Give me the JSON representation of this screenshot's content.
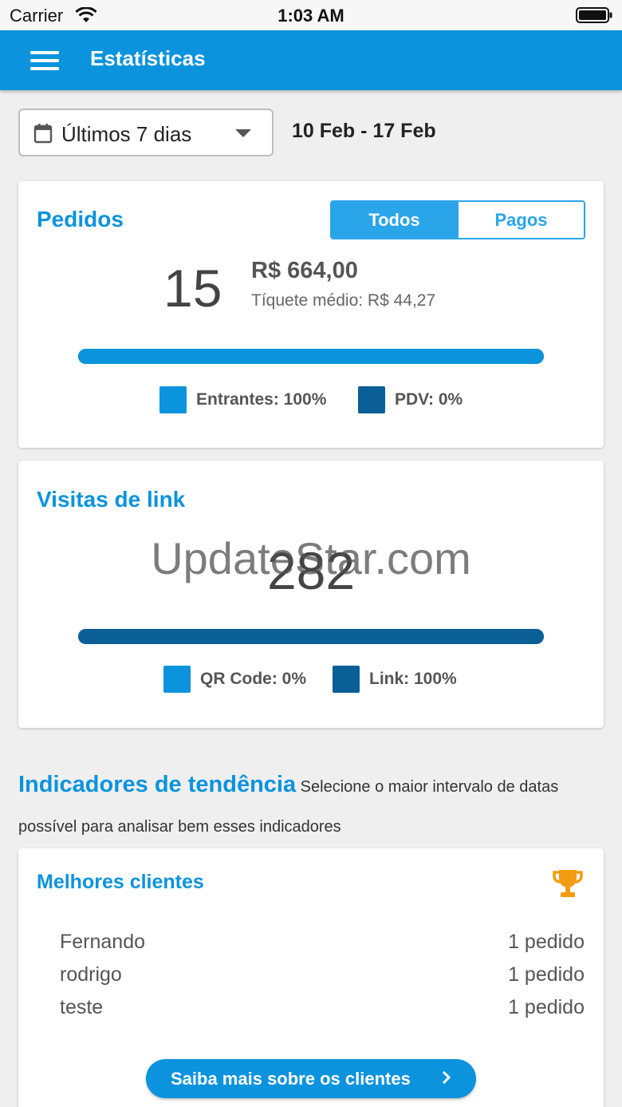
{
  "status_bar": {
    "carrier": "Carrier",
    "time": "1:03 AM"
  },
  "app_bar": {
    "title": "Estatísticas"
  },
  "filter": {
    "range_label": "Últimos 7 dias",
    "dates": "10 Feb - 17 Feb"
  },
  "orders": {
    "title": "Pedidos",
    "tabs": [
      {
        "label": "Todos",
        "active": true
      },
      {
        "label": "Pagos",
        "active": false
      }
    ],
    "count": "15",
    "total": "R$ 664,00",
    "ticket": "Tíquete médio: R$ 44,27",
    "bar_share_incoming": 1.0,
    "legend": [
      {
        "label": "Entrantes: 100%",
        "color": "#0b93dd"
      },
      {
        "label": "PDV: 0%",
        "color": "#0a5f96"
      }
    ]
  },
  "visits": {
    "title": "Visitas de link",
    "count": "282",
    "watermark": "UpdateStar.com",
    "bar_share_link": 1.0,
    "legend": [
      {
        "label": "QR Code: 0%",
        "color": "#0b93dd"
      },
      {
        "label": "Link: 100%",
        "color": "#0a5f96"
      }
    ]
  },
  "trends": {
    "title": "Indicadores de tendência",
    "description": "Selecione o maior intervalo de datas possível para analisar bem esses indicadores"
  },
  "best_clients": {
    "title": "Melhores clientes",
    "icon": "trophy-icon",
    "rows": [
      {
        "name": "Fernando",
        "count": "1 pedido"
      },
      {
        "name": "rodrigo",
        "count": "1 pedido"
      },
      {
        "name": "teste",
        "count": "1 pedido"
      }
    ],
    "button_label": "Saiba mais sobre os clientes"
  },
  "colors": {
    "primary": "#0b93dd",
    "dark": "#0a5f96",
    "accent": "#2aa5e9",
    "trophy": "#f39c12"
  }
}
